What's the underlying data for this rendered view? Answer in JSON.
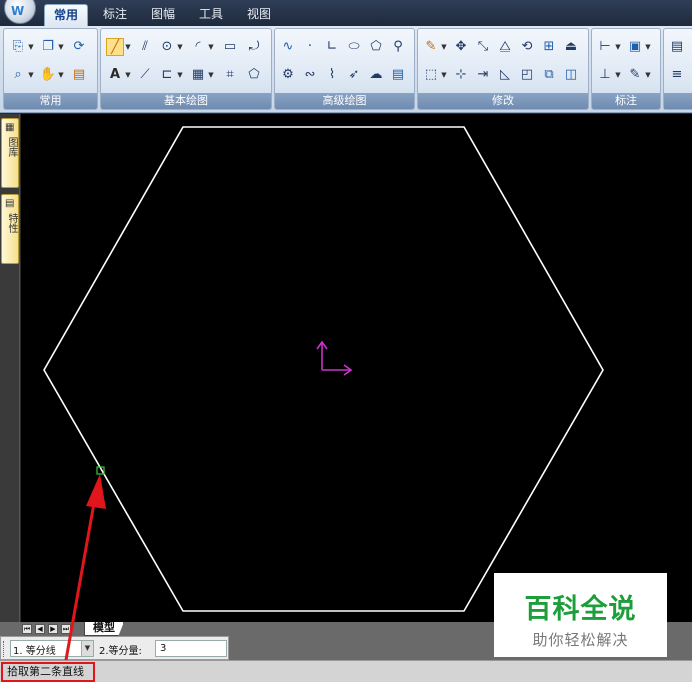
{
  "app": {
    "logo_text": "W"
  },
  "menu": {
    "tabs": [
      {
        "label": "常用",
        "active": true
      },
      {
        "label": "标注",
        "active": false
      },
      {
        "label": "图幅",
        "active": false
      },
      {
        "label": "工具",
        "active": false
      },
      {
        "label": "视图",
        "active": false
      }
    ]
  },
  "ribbon": {
    "groups": [
      {
        "label": "常用"
      },
      {
        "label": "基本绘图"
      },
      {
        "label": "高级绘图"
      },
      {
        "label": "修改"
      },
      {
        "label": "标注"
      }
    ],
    "text_tool_glyph": "A"
  },
  "dock": {
    "tabs": [
      {
        "label": "图库"
      },
      {
        "label": "特性"
      }
    ]
  },
  "layout_tabs": {
    "model": "模型"
  },
  "command": {
    "mode_label": "1. 等分线",
    "count_label": "2.等分量:",
    "count_value": "3"
  },
  "status": {
    "prompt": "拾取第二条直线"
  },
  "watermark": {
    "main": "百科全说",
    "sub": "助你轻松解决"
  },
  "colors": {
    "canvas_bg": "#000000",
    "hexagon_stroke": "#ffffff",
    "ucs_axis": "#cc33cc",
    "pick_marker": "#33cc33",
    "annotation_red": "#e0161c",
    "watermark_green": "#1e9e3a"
  }
}
